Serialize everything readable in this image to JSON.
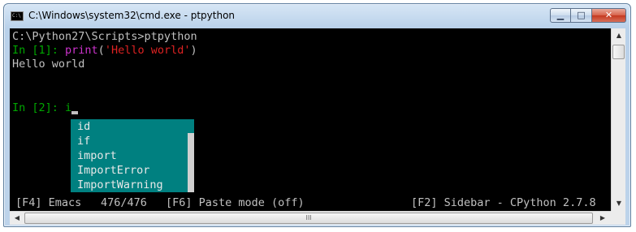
{
  "window": {
    "title": "C:\\Windows\\system32\\cmd.exe - ptpython",
    "icon": "cmd-icon",
    "icon_text": "C:\\",
    "controls": {
      "minimize": "▁",
      "maximize": "□",
      "close": "✕"
    }
  },
  "console": {
    "lines": [
      {
        "text": "C:\\Python27\\Scripts>ptpython"
      },
      {
        "prompt": "In [1]: ",
        "func": "print",
        "open": "(",
        "string": "'Hello world'",
        "close": ")"
      },
      {
        "text": "Hello world"
      },
      {
        "prompt": "In [2]: ",
        "input": "i"
      }
    ],
    "completions": [
      "id",
      "if",
      "import",
      "ImportError",
      "ImportWarning"
    ]
  },
  "statusbar": {
    "left": "[F4] Emacs",
    "count": "476/476",
    "paste": "[F6] Paste mode (off)",
    "sidebar": "[F2] Sidebar - CPython 2.7.8"
  },
  "scrollbars": {
    "up_arrow": "▲",
    "down_arrow": "▼",
    "left_arrow": "◀",
    "right_arrow": "▶",
    "grip": "III"
  },
  "colors": {
    "background": "#000000",
    "text": "#c0c0c0",
    "prompt": "#00a600",
    "keyword": "#cc33cc",
    "string": "#dd2222",
    "completion_bg": "#008080"
  }
}
